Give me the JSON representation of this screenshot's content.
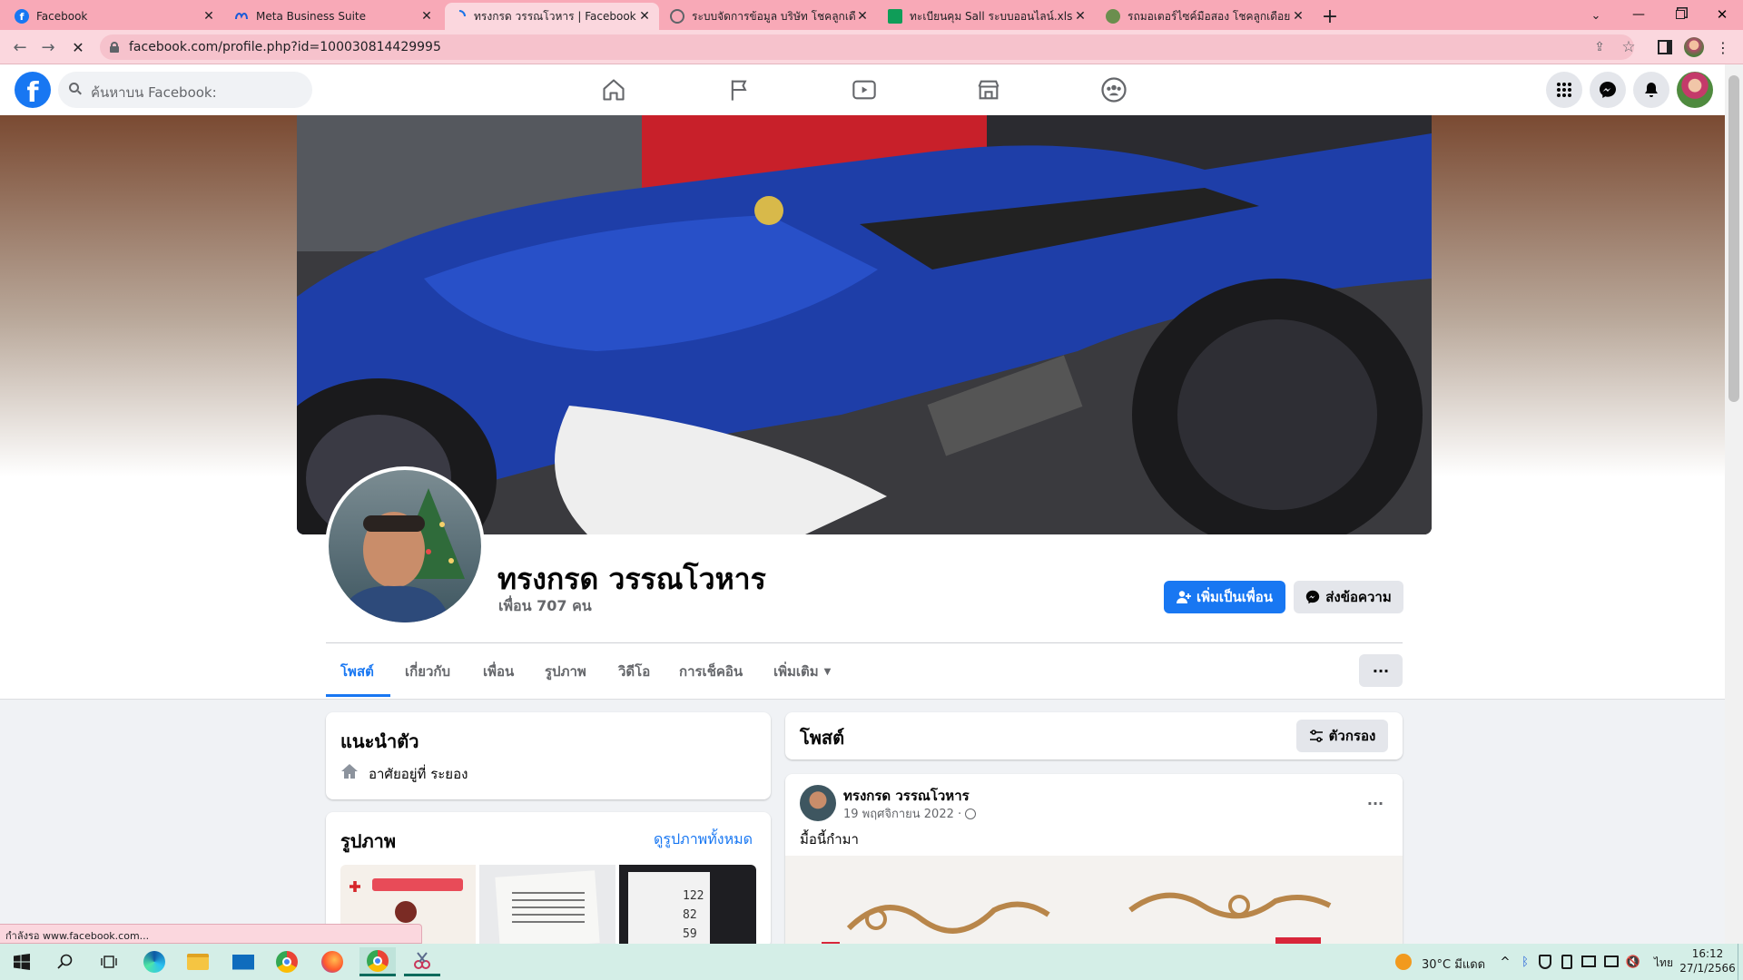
{
  "browser": {
    "tabs": [
      {
        "title": "Facebook"
      },
      {
        "title": "Meta Business Suite"
      },
      {
        "title": "ทรงกรด วรรณโวหาร | Facebook"
      },
      {
        "title": "ระบบจัดการข้อมูล บริษัท โชคลูกเดือย"
      },
      {
        "title": "ทะเบียนคุม Sall ระบบออนไลน์.xlsx - G"
      },
      {
        "title": "รถมอเตอร์ไซค์มือสอง โชคลูกเดือย อุดรธานี"
      }
    ],
    "new_tab": "+",
    "url": "facebook.com/profile.php?id=100030814429995",
    "status_text": "กำลังรอ www.facebook.com..."
  },
  "facebook": {
    "logo_letter": "f",
    "search_placeholder": "ค้นหาบน Facebook:",
    "brand_color": "#1877f2"
  },
  "profile": {
    "name": "ทรงกรด วรรณโวหาร",
    "friends": "เพื่อน 707 คน",
    "add_friend": "เพิ่มเป็นเพื่อน",
    "message": "ส่งข้อความ",
    "tabs": [
      "โพสต์",
      "เกี่ยวกับ",
      "เพื่อน",
      "รูปภาพ",
      "วิดีโอ",
      "การเช็คอิน",
      "เพิ่มเติม"
    ],
    "more_menu": "···"
  },
  "intro": {
    "title": "แนะนำตัว",
    "lives_in": "อาศัยอยู่ที่ ระยอง"
  },
  "photos": {
    "title": "รูปภาพ",
    "see_all": "ดูรูปภาพทั้งหมด",
    "thumb3_lines": [
      "122",
      "82",
      "59"
    ]
  },
  "posts": {
    "title": "โพสต์",
    "filter": "ตัวกรอง",
    "post": {
      "author": "ทรงกรด วรรณโวหาร",
      "date": "19 พฤศจิกายน 2022 ·",
      "text": "มื้อนี้กำมา",
      "menu": "···"
    }
  },
  "taskbar": {
    "weather": "30°C  มีแดด",
    "lang": "ไทย",
    "time": "16:12",
    "date": "27/1/2566"
  }
}
